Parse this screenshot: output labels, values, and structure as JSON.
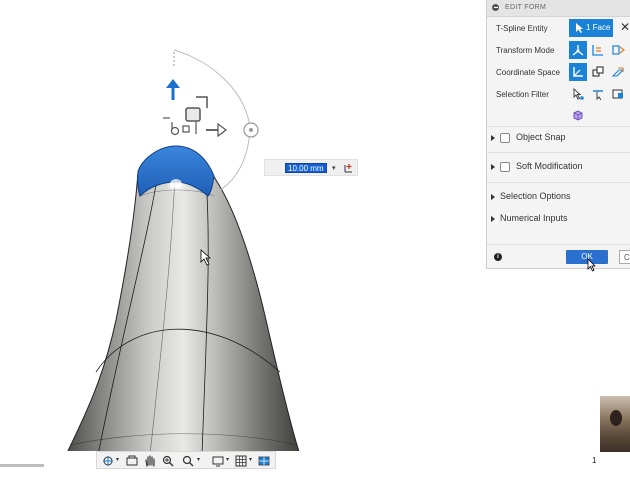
{
  "panel": {
    "title": "EDIT FORM",
    "rows": [
      {
        "label": "T-Spline Entity",
        "value": "1 Face"
      },
      {
        "label": "Transform Mode"
      },
      {
        "label": "Coordinate Space"
      },
      {
        "label": "Selection Filter"
      }
    ],
    "sections": [
      "Object Snap",
      "Soft Modification",
      "Selection Options",
      "Numerical Inputs"
    ],
    "ok_label": "OK",
    "cancel_label": "C",
    "close_glyph": "✕",
    "info_glyph": "i"
  },
  "viewport": {
    "dimension_input": "10.00 mm",
    "dropdown_caret": "▾"
  },
  "bottom": {
    "page_indicator": "1"
  },
  "colors": {
    "accent": "#1a83d8",
    "selected_face": "#2a6fc7",
    "arrow_blue": "#1a6fd0"
  }
}
